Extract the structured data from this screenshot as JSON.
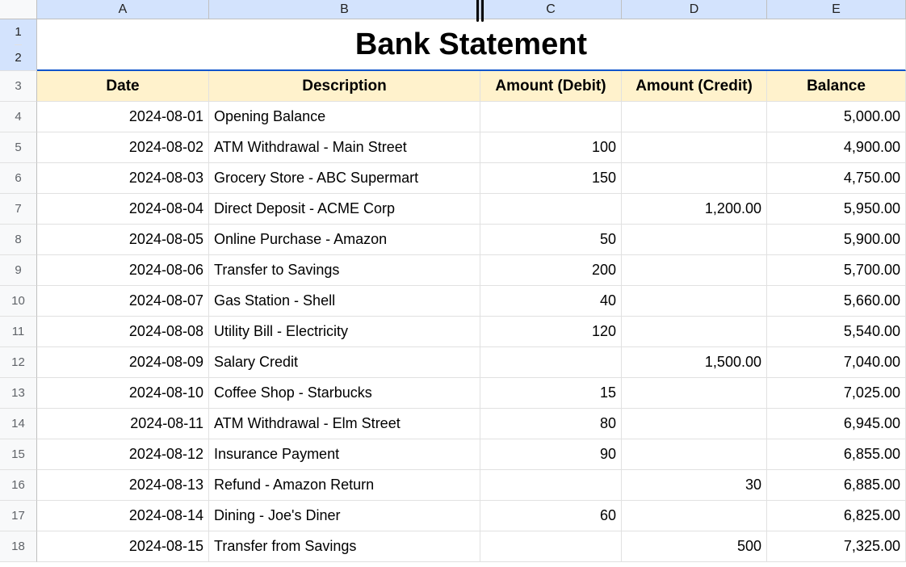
{
  "columns": [
    "A",
    "B",
    "C",
    "D",
    "E"
  ],
  "title": "Bank Statement",
  "headers": {
    "date": "Date",
    "description": "Description",
    "debit": "Amount (Debit)",
    "credit": "Amount (Credit)",
    "balance": "Balance"
  },
  "title_row_labels": [
    "1",
    "2"
  ],
  "header_row_label": "3",
  "rows": [
    {
      "n": "4",
      "date": "2024-08-01",
      "desc": "Opening Balance",
      "debit": "",
      "credit": "",
      "balance": "5,000.00"
    },
    {
      "n": "5",
      "date": "2024-08-02",
      "desc": "ATM Withdrawal - Main Street",
      "debit": "100",
      "credit": "",
      "balance": "4,900.00"
    },
    {
      "n": "6",
      "date": "2024-08-03",
      "desc": "Grocery Store - ABC Supermart",
      "debit": "150",
      "credit": "",
      "balance": "4,750.00"
    },
    {
      "n": "7",
      "date": "2024-08-04",
      "desc": "Direct Deposit - ACME Corp",
      "debit": "",
      "credit": "1,200.00",
      "balance": "5,950.00"
    },
    {
      "n": "8",
      "date": "2024-08-05",
      "desc": "Online Purchase - Amazon",
      "debit": "50",
      "credit": "",
      "balance": "5,900.00"
    },
    {
      "n": "9",
      "date": "2024-08-06",
      "desc": "Transfer to Savings",
      "debit": "200",
      "credit": "",
      "balance": "5,700.00"
    },
    {
      "n": "10",
      "date": "2024-08-07",
      "desc": "Gas Station - Shell",
      "debit": "40",
      "credit": "",
      "balance": "5,660.00"
    },
    {
      "n": "11",
      "date": "2024-08-08",
      "desc": "Utility Bill - Electricity",
      "debit": "120",
      "credit": "",
      "balance": "5,540.00"
    },
    {
      "n": "12",
      "date": "2024-08-09",
      "desc": "Salary Credit",
      "debit": "",
      "credit": "1,500.00",
      "balance": "7,040.00"
    },
    {
      "n": "13",
      "date": "2024-08-10",
      "desc": "Coffee Shop - Starbucks",
      "debit": "15",
      "credit": "",
      "balance": "7,025.00"
    },
    {
      "n": "14",
      "date": "2024-08-11",
      "desc": "ATM Withdrawal - Elm Street",
      "debit": "80",
      "credit": "",
      "balance": "6,945.00"
    },
    {
      "n": "15",
      "date": "2024-08-12",
      "desc": "Insurance Payment",
      "debit": "90",
      "credit": "",
      "balance": "6,855.00"
    },
    {
      "n": "16",
      "date": "2024-08-13",
      "desc": "Refund - Amazon Return",
      "debit": "",
      "credit": "30",
      "balance": "6,885.00"
    },
    {
      "n": "17",
      "date": "2024-08-14",
      "desc": "Dining - Joe's Diner",
      "debit": "60",
      "credit": "",
      "balance": "6,825.00"
    },
    {
      "n": "18",
      "date": "2024-08-15",
      "desc": "Transfer from Savings",
      "debit": "",
      "credit": "500",
      "balance": "7,325.00"
    }
  ]
}
